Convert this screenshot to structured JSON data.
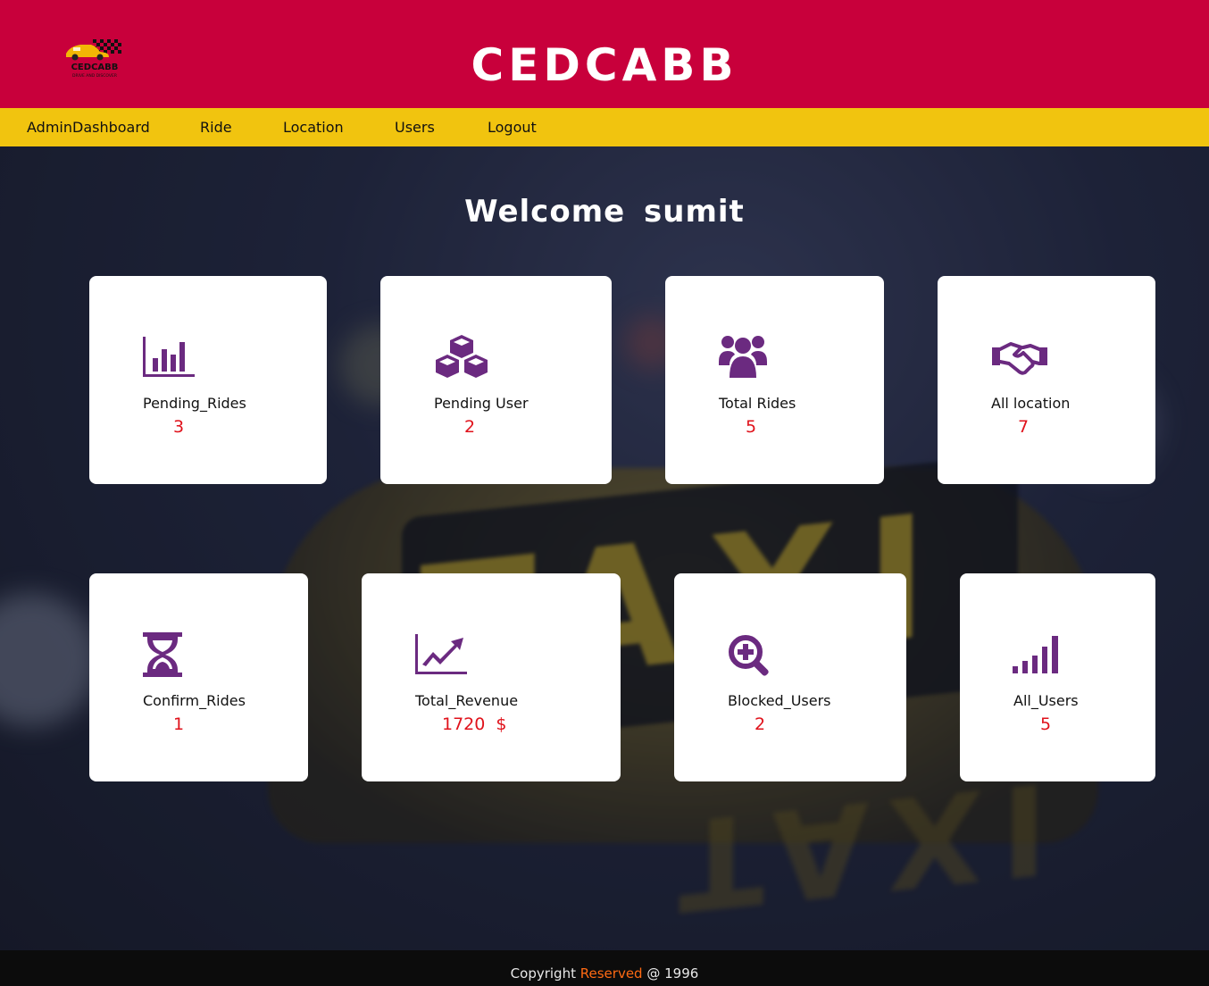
{
  "header": {
    "logo_text": "CEDCABB",
    "logo_tagline": "DRIVE AND DISCOVER",
    "title": "CEDCABB"
  },
  "nav": {
    "items": [
      "AdminDashboard",
      "Ride",
      "Location",
      "Users",
      "Logout"
    ]
  },
  "main": {
    "welcome_word": "Welcome",
    "username": "sumit",
    "cards": [
      {
        "label": "Pending_Rides",
        "value": "3",
        "icon": "bar-chart-icon"
      },
      {
        "label": "Pending User",
        "value": "2",
        "icon": "cubes-icon"
      },
      {
        "label": "Total Rides",
        "value": "5",
        "icon": "users-group-icon"
      },
      {
        "label": "All location",
        "value": "7",
        "icon": "handshake-icon"
      },
      {
        "label": "Confirm_Rides",
        "value": "1",
        "icon": "hourglass-icon"
      },
      {
        "label": "Total_Revenue",
        "value": "1720  $",
        "icon": "line-chart-icon"
      },
      {
        "label": "Blocked_Users",
        "value": "2",
        "icon": "search-plus-icon"
      },
      {
        "label": "All_Users",
        "value": "5",
        "icon": "signal-icon"
      }
    ]
  },
  "footer": {
    "prefix": "Copyright",
    "accent": "Reserved",
    "suffix": "@ 1996"
  },
  "colors": {
    "header_bg": "#c8003b",
    "nav_bg": "#f1c40f",
    "icon_purple": "#6b2a80",
    "value_red": "#e0121b",
    "footer_accent": "#ff6a13"
  }
}
